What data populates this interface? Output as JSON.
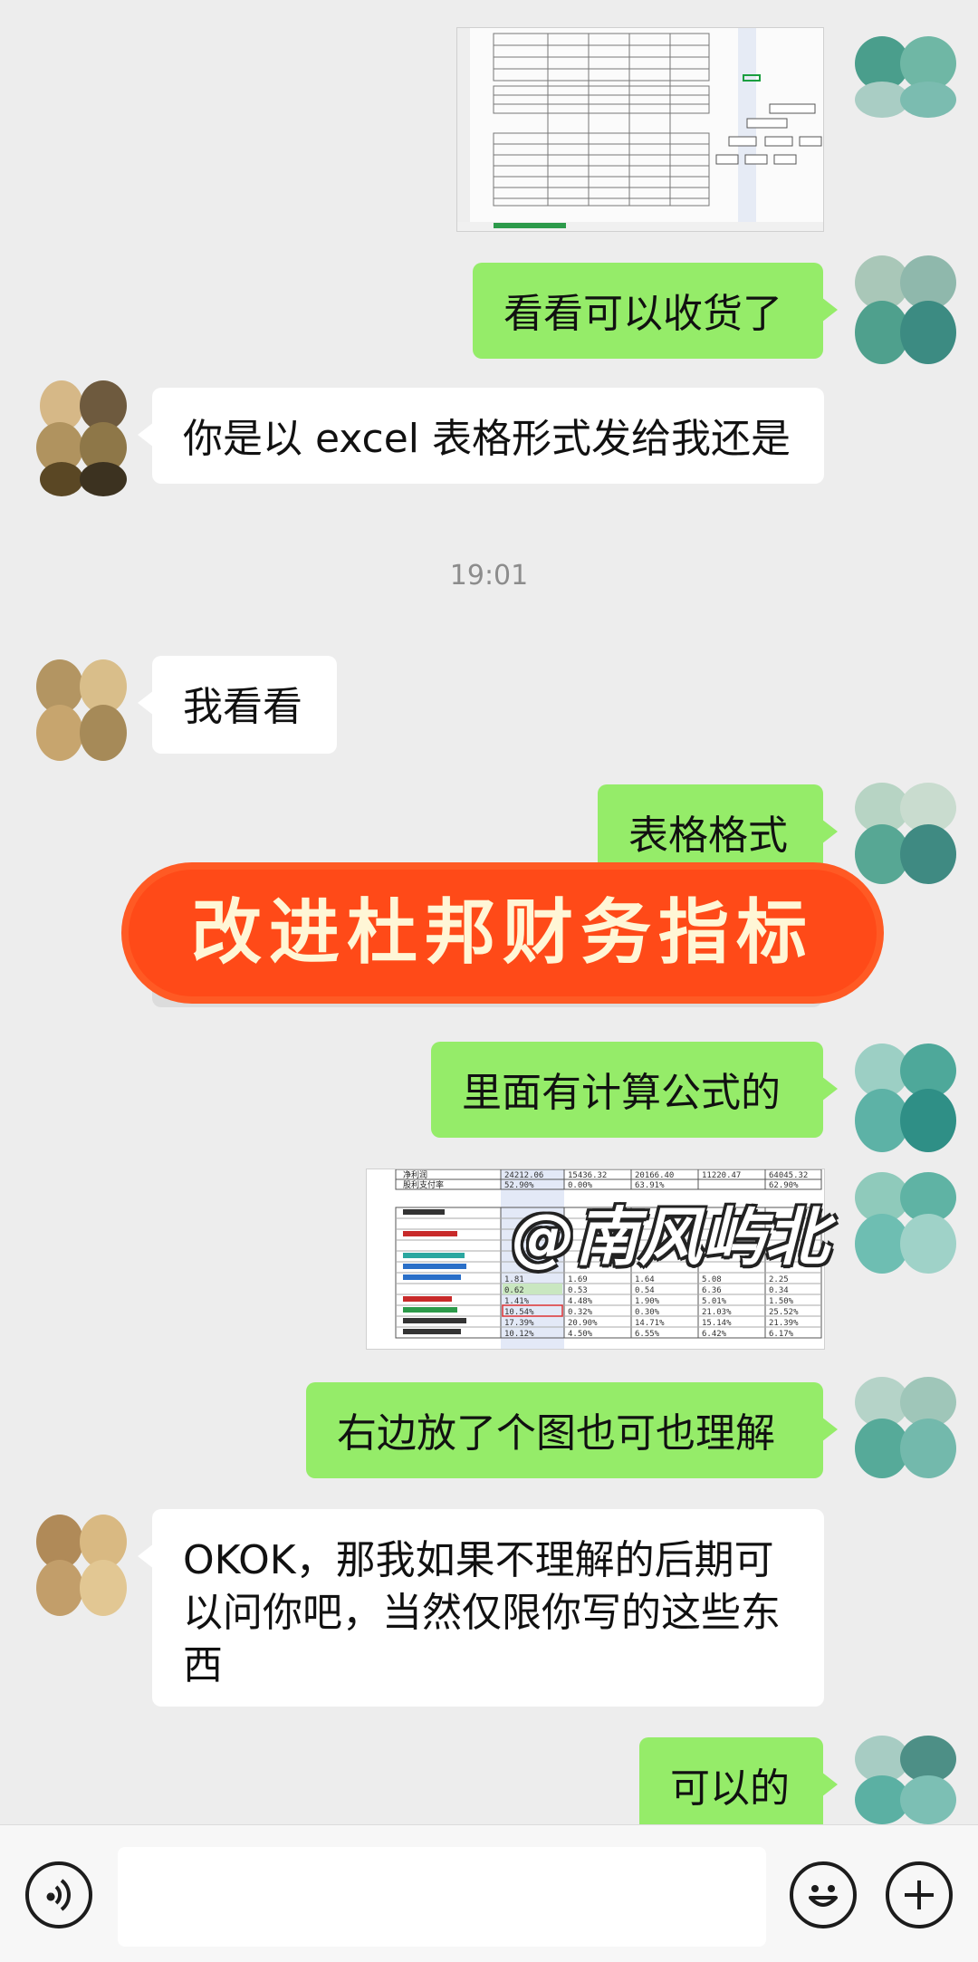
{
  "messages": [
    {
      "id": "m1",
      "from": "me",
      "text": "看看可以收货了"
    },
    {
      "id": "m2",
      "from": "them",
      "text": "你是以 excel 表格形式发给我还是"
    },
    {
      "id": "m3",
      "from": "them",
      "text": "我看看"
    },
    {
      "id": "m4",
      "from": "me",
      "text": "表格格式"
    },
    {
      "id": "m5",
      "from": "me",
      "text": "里面有计算公式的"
    },
    {
      "id": "m6",
      "from": "me",
      "text": "右边放了个图也可也理解"
    },
    {
      "id": "m7",
      "from": "them",
      "text": "OKOK，那我如果不理解的后期可以问你吧，当然仅限你写的这些东西"
    },
    {
      "id": "m8",
      "from": "me",
      "text": "可以的"
    }
  ],
  "timestamp": "19:01",
  "overlay": {
    "banner_text": "改进杜邦财务指标",
    "watermark_text": "@南风屿北",
    "banner_color": "#ff4a18"
  },
  "spreadsheet_preview": {
    "header_row": [
      "净利润",
      "24212.06",
      "15436.32",
      "20166.40",
      "11220.47",
      "64045.32"
    ],
    "header_row2": [
      "股利支付率",
      "52.90%",
      "0.00%",
      "63.91%",
      "",
      "62.90%"
    ],
    "rows": [
      [
        "",
        "1.81",
        "1.69",
        "1.64",
        "5.08",
        "2.25"
      ],
      [
        "",
        "0.62",
        "0.53",
        "0.54",
        "6.36",
        "0.34"
      ],
      [
        "",
        "1.41%",
        "4.48%",
        "1.90%",
        "5.01%",
        "1.50%"
      ],
      [
        "",
        "10.54%",
        "0.32%",
        "0.30%",
        "21.03%",
        "25.52%"
      ],
      [
        "",
        "17.39%",
        "20.90%",
        "14.71%",
        "15.14%",
        "21.39%"
      ],
      [
        "",
        "10.12%",
        "4.50%",
        "6.55%",
        "6.42%",
        "6.17%"
      ]
    ]
  },
  "colors": {
    "me_bubble": "#95ec69",
    "them_bubble": "#ffffff",
    "background": "#ededed"
  },
  "icons": {
    "voice": "voice-icon",
    "emoji": "emoji-icon",
    "more": "plus-icon"
  }
}
